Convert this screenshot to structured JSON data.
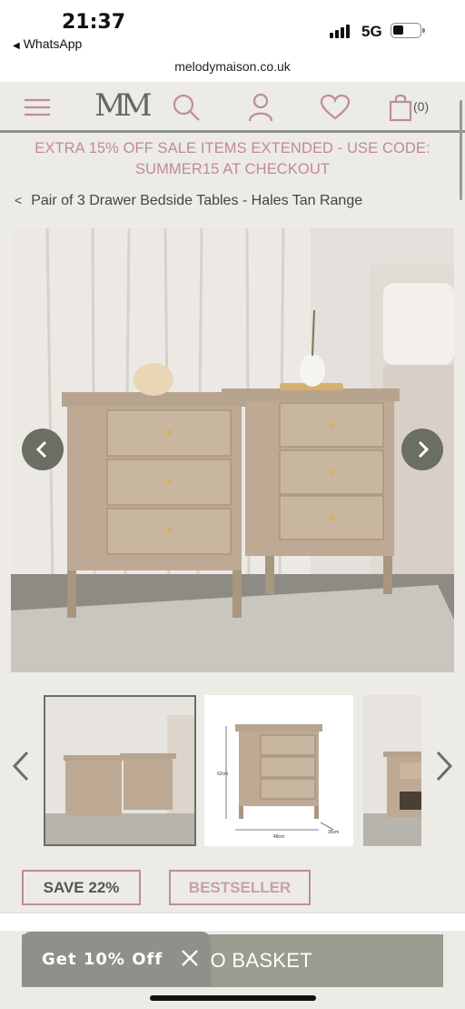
{
  "status_bar": {
    "time": "21:37",
    "back_app": "WhatsApp",
    "network": "5G"
  },
  "url": "melodymaison.co.uk",
  "nav": {
    "logo": "MM",
    "cart_count": "(0)",
    "icons": [
      "menu-icon",
      "search-icon",
      "account-icon",
      "wishlist-icon",
      "cart-icon"
    ]
  },
  "promo_banner": "EXTRA 15% OFF SALE ITEMS EXTENDED - USE CODE: SUMMER15 AT CHECKOUT",
  "breadcrumb": {
    "back_icon": "<",
    "label": "Pair of 3 Drawer Bedside Tables - Hales Tan Range"
  },
  "gallery": {
    "prev_icon": "chevron-left-icon",
    "next_icon": "chevron-right-icon"
  },
  "thumbnails": {
    "dimension_height": "62cm",
    "dimension_width": "48cm",
    "dimension_depth": "35cm"
  },
  "badges": {
    "save": "SAVE 22%",
    "bestseller": "BESTSELLER"
  },
  "add_to_basket_partial": "O BASKET",
  "discount_popup": {
    "label": "Get 10% Off"
  },
  "colors": {
    "accent_pink": "#c08d94",
    "sage": "#8d918a",
    "background": "#ecebe6"
  }
}
